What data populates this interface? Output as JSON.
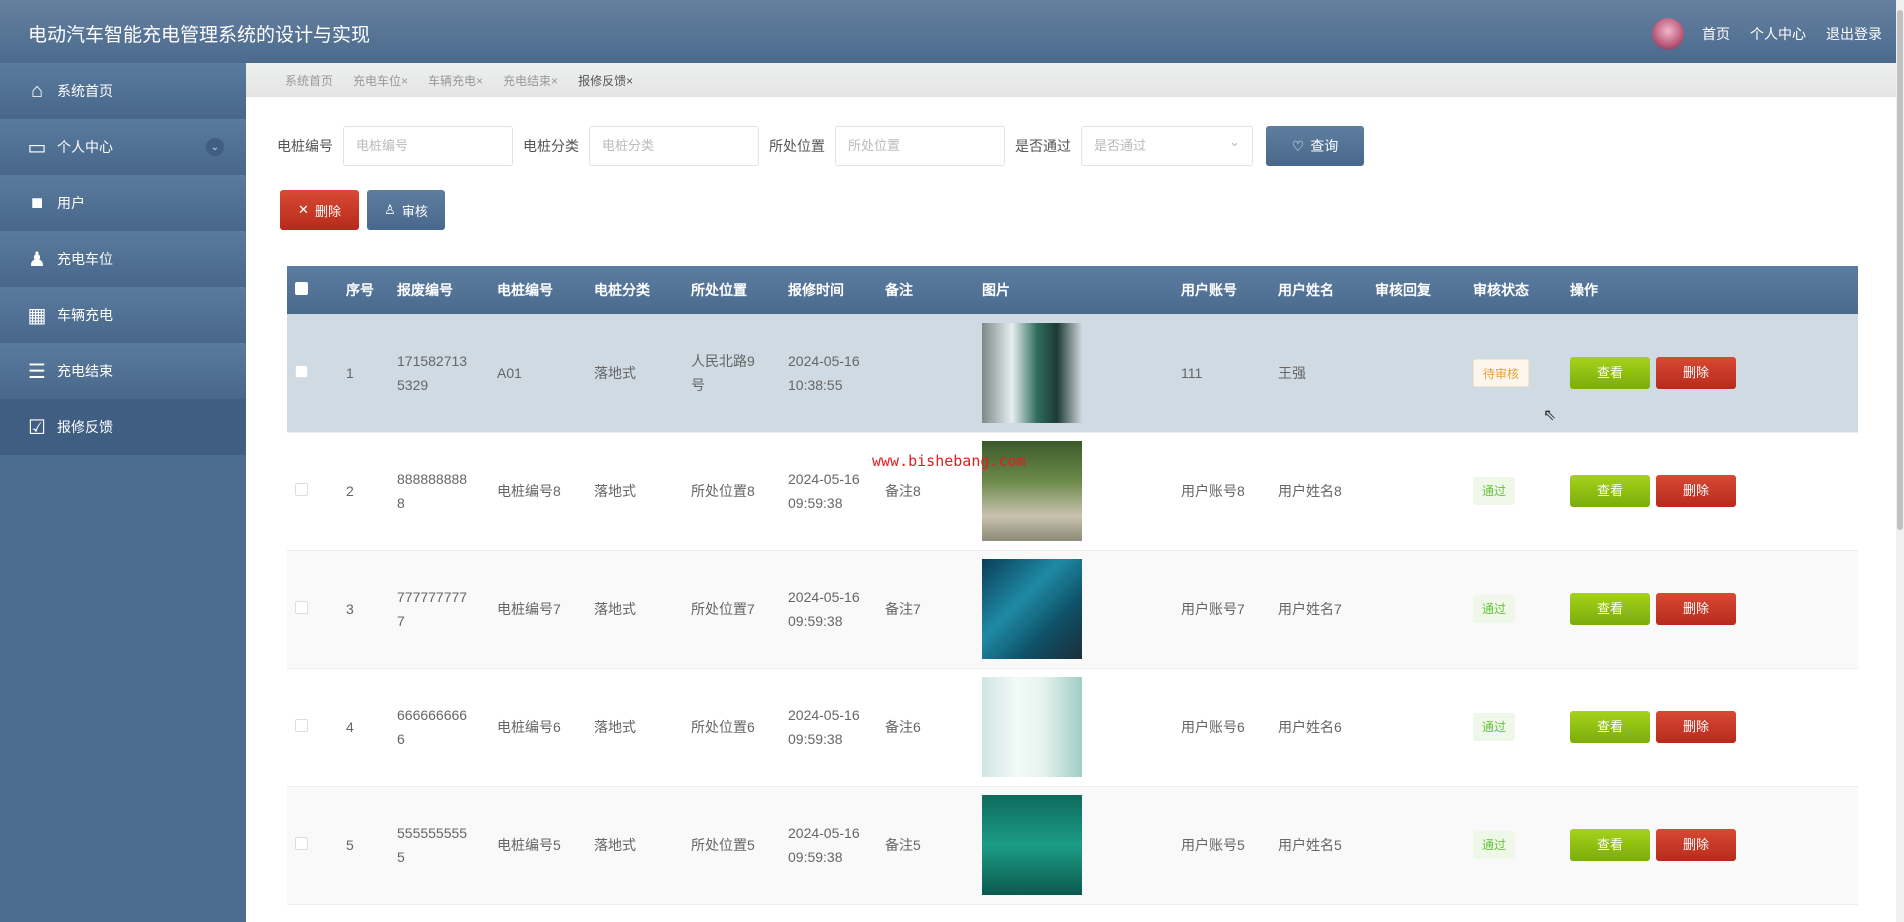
{
  "header": {
    "title": "电动汽车智能充电管理系统的设计与实现",
    "links": [
      "首页",
      "个人中心",
      "退出登录"
    ]
  },
  "sidebar": {
    "items": [
      {
        "label": "系统首页",
        "icon": "home-icon"
      },
      {
        "label": "个人中心",
        "icon": "card-icon"
      },
      {
        "label": "用户",
        "icon": "briefcase-icon"
      },
      {
        "label": "充电车位",
        "icon": "user-stamp-icon"
      },
      {
        "label": "车辆充电",
        "icon": "grid-icon"
      },
      {
        "label": "充电结束",
        "icon": "list-arrow-icon"
      },
      {
        "label": "报修反馈",
        "icon": "clipboard-check-icon"
      }
    ]
  },
  "tabs": [
    "系统首页",
    "充电车位×",
    "车辆充电×",
    "充电结束×",
    "报修反馈×"
  ],
  "search": {
    "f1_label": "电桩编号",
    "f1_ph": "电桩编号",
    "f2_label": "电桩分类",
    "f2_ph": "电桩分类",
    "f3_label": "所处位置",
    "f3_ph": "所处位置",
    "f4_label": "是否通过",
    "f4_ph": "是否通过",
    "query": "查询"
  },
  "actions": {
    "delete": "删除",
    "audit": "审核"
  },
  "table": {
    "headers": [
      "序号",
      "报废编号",
      "电桩编号",
      "电桩分类",
      "所处位置",
      "报修时间",
      "备注",
      "图片",
      "用户账号",
      "用户姓名",
      "审核回复",
      "审核状态",
      "操作"
    ],
    "view": "查看",
    "del": "删除",
    "rows": [
      {
        "n": "1",
        "code": "1715827135329",
        "pile": "A01",
        "type": "落地式",
        "loc": "人民北路9号",
        "time": "2024-05-16 10:38:55",
        "note": "",
        "acct": "111",
        "name": "王强",
        "reply": "",
        "status": "待审核"
      },
      {
        "n": "2",
        "code": "8888888888",
        "pile": "电桩编号8",
        "type": "落地式",
        "loc": "所处位置8",
        "time": "2024-05-16 09:59:38",
        "note": "备注8",
        "acct": "用户账号8",
        "name": "用户姓名8",
        "reply": "",
        "status": "通过"
      },
      {
        "n": "3",
        "code": "7777777777",
        "pile": "电桩编号7",
        "type": "落地式",
        "loc": "所处位置7",
        "time": "2024-05-16 09:59:38",
        "note": "备注7",
        "acct": "用户账号7",
        "name": "用户姓名7",
        "reply": "",
        "status": "通过"
      },
      {
        "n": "4",
        "code": "6666666666",
        "pile": "电桩编号6",
        "type": "落地式",
        "loc": "所处位置6",
        "time": "2024-05-16 09:59:38",
        "note": "备注6",
        "acct": "用户账号6",
        "name": "用户姓名6",
        "reply": "",
        "status": "通过"
      },
      {
        "n": "5",
        "code": "5555555555",
        "pile": "电桩编号5",
        "type": "落地式",
        "loc": "所处位置5",
        "time": "2024-05-16 09:59:38",
        "note": "备注5",
        "acct": "用户账号5",
        "name": "用户姓名5",
        "reply": "",
        "status": "通过"
      }
    ]
  },
  "watermark": "www.bishebang.com",
  "colors": {
    "header": "#4b6a8e",
    "danger": "#c0301f",
    "success": "#8bbd10"
  }
}
